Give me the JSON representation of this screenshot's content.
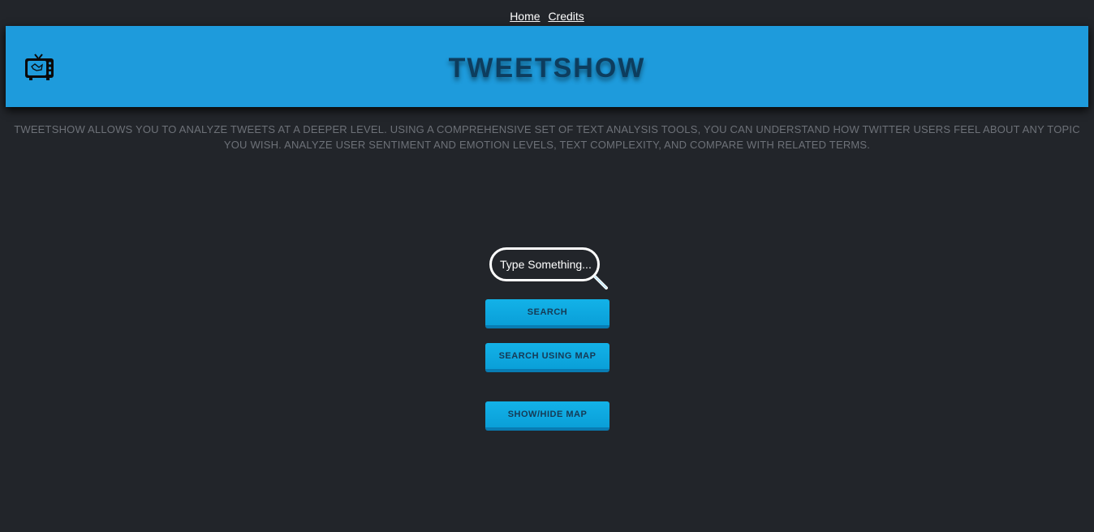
{
  "nav": {
    "home_label": "Home",
    "credits_label": "Credits"
  },
  "header": {
    "title": "TWEETSHOW",
    "logo_icon": "tv-icon"
  },
  "description": "TWEETSHOW ALLOWS YOU TO ANALYZE TWEETS AT A DEEPER LEVEL. USING A COMPREHENSIVE SET OF TEXT ANALYSIS TOOLS, YOU CAN UNDERSTAND HOW TWITTER USERS FEEL ABOUT ANY TOPIC YOU WISH. ANALYZE USER SENTIMENT AND EMOTION LEVELS, TEXT COMPLEXITY, AND COMPARE WITH RELATED TERMS.",
  "search": {
    "placeholder": "Type Something...",
    "value": "",
    "icon": "magnifier-icon"
  },
  "buttons": {
    "search_label": "SEARCH",
    "search_map_label": "SEARCH USING MAP",
    "toggle_map_label": "SHOW/HIDE MAP"
  },
  "colors": {
    "background": "#22252a",
    "banner": "#1e9bdc",
    "title": "#0d3d5e",
    "button": "#0fa8e0",
    "button_text": "#163a55",
    "description": "#6d7178"
  }
}
